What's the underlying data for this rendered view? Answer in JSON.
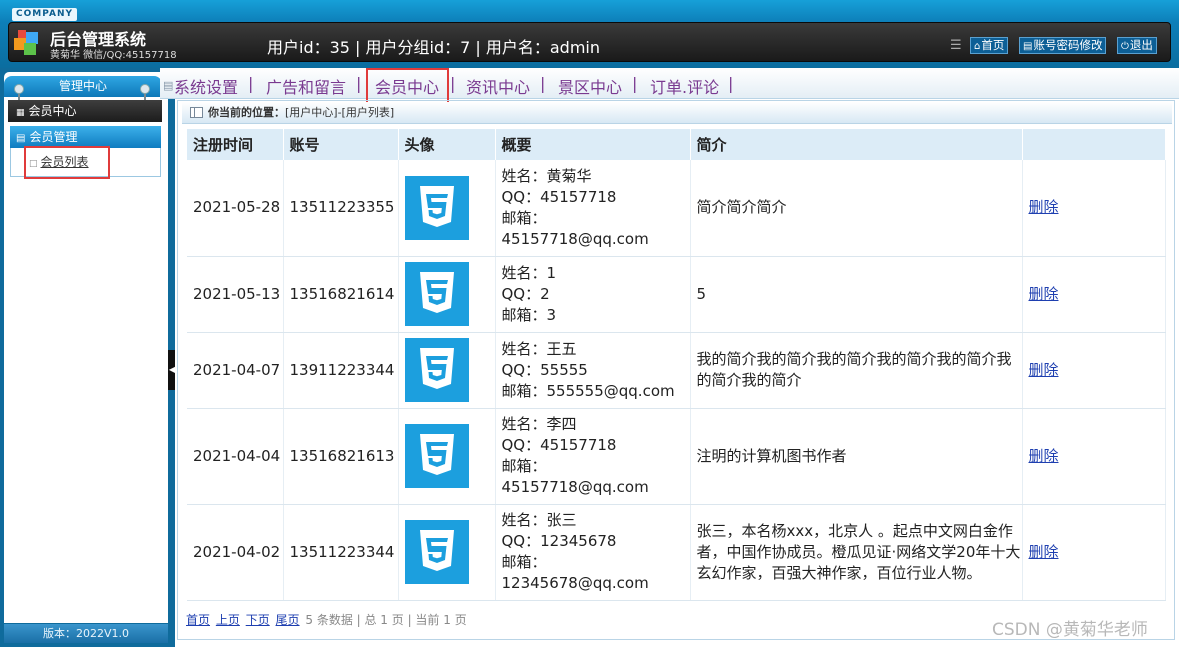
{
  "header": {
    "company": "COMPANY",
    "title": "后台管理系统",
    "subtitle": "黄菊华 微信/QQ:45157718",
    "user_info": "用户id：35 | 用户分组id：7 | 用户名：admin",
    "menu_icon": "menu-icon",
    "buttons": [
      {
        "icon": "home-icon",
        "label": "首页"
      },
      {
        "icon": "list-icon",
        "label": "账号密码修改"
      },
      {
        "icon": "power-icon",
        "label": "退出"
      }
    ]
  },
  "sidebar": {
    "title": "管理中心",
    "section": "会员中心",
    "group": "会员管理",
    "link": "会员列表",
    "version": "版本：2022V1.0"
  },
  "topnav": {
    "items": [
      "系统设置",
      "广告和留言",
      "会员中心",
      "资讯中心",
      "景区中心",
      "订单.评论"
    ],
    "active": "会员中心"
  },
  "location": {
    "label": "你当前的位置：",
    "path": "[用户中心]-[用户列表]"
  },
  "table": {
    "headers": [
      "注册时间",
      "账号",
      "头像",
      "概要",
      "简介",
      ""
    ],
    "rows": [
      {
        "date": "2021-05-28",
        "account": "13511223355",
        "name": "姓名：黄菊华",
        "qq": "QQ：45157718",
        "email_label": "邮箱：",
        "email": "45157718@qq.com",
        "intro": "简介简介简介",
        "action": "删除"
      },
      {
        "date": "2021-05-13",
        "account": "13516821614",
        "name": "姓名：1",
        "qq": "QQ：2",
        "email_label": "邮箱：3",
        "email": "",
        "intro": "5",
        "action": "删除"
      },
      {
        "date": "2021-04-07",
        "account": "13911223344",
        "name": "姓名：王五",
        "qq": "QQ：55555",
        "email_label": "邮箱：555555@qq.com",
        "email": "",
        "intro": "我的简介我的简介我的简介我的简介我的简介我的简介我的简介",
        "action": "删除"
      },
      {
        "date": "2021-04-04",
        "account": "13516821613",
        "name": "姓名：李四",
        "qq": "QQ：45157718",
        "email_label": "邮箱：",
        "email": "45157718@qq.com",
        "intro": "注明的计算机图书作者",
        "action": "删除"
      },
      {
        "date": "2021-04-02",
        "account": "13511223344",
        "name": "姓名：张三",
        "qq": "QQ：12345678",
        "email_label": "邮箱：",
        "email": "12345678@qq.com",
        "intro": "张三，本名杨xxx，北京人 。起点中文网白金作者，中国作协成员。橙瓜见证·网络文学20年十大玄幻作家，百强大神作家，百位行业人物。",
        "action": "删除"
      }
    ]
  },
  "pager": {
    "first": "首页",
    "prev": "上页",
    "next": "下页",
    "last": "尾页",
    "summary": "5 条数据 | 总 1 页 | 当前 1 页"
  },
  "watermark": "CSDN @黄菊华老师"
}
